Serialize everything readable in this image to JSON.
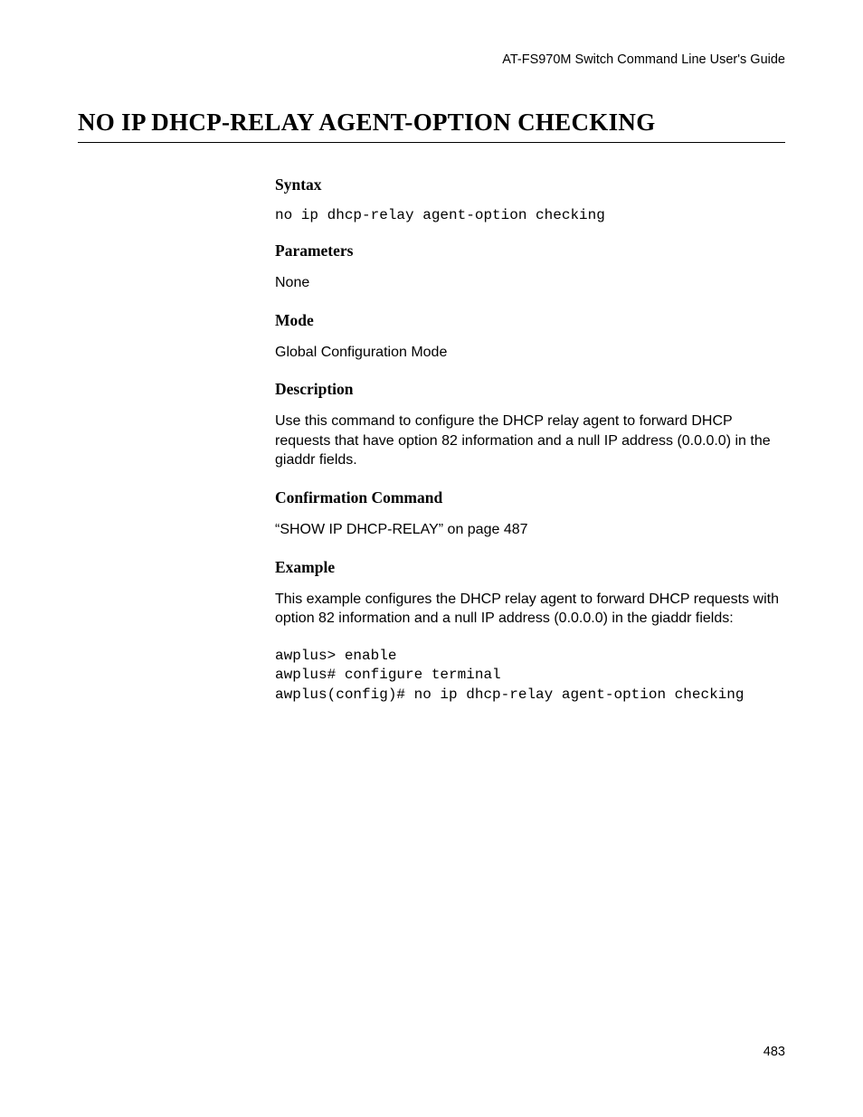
{
  "header": {
    "guide_title": "AT-FS970M Switch Command Line User's Guide"
  },
  "title": "NO IP DHCP-RELAY AGENT-OPTION CHECKING",
  "sections": {
    "syntax": {
      "heading": "Syntax",
      "code": "no ip dhcp-relay agent-option checking"
    },
    "parameters": {
      "heading": "Parameters",
      "text": "None"
    },
    "mode": {
      "heading": "Mode",
      "text": "Global Configuration Mode"
    },
    "description": {
      "heading": "Description",
      "text": "Use this command to configure the DHCP relay agent to forward DHCP requests that have option 82 information and a null IP address (0.0.0.0) in the giaddr fields."
    },
    "confirmation": {
      "heading": "Confirmation Command",
      "text": "“SHOW IP DHCP-RELAY” on page 487"
    },
    "example": {
      "heading": "Example",
      "text": "This example configures the DHCP relay agent to forward DHCP requests with option 82 information and a null IP address (0.0.0.0) in the giaddr fields:",
      "code": "awplus> enable\nawplus# configure terminal\nawplus(config)# no ip dhcp-relay agent-option checking"
    }
  },
  "page_number": "483"
}
